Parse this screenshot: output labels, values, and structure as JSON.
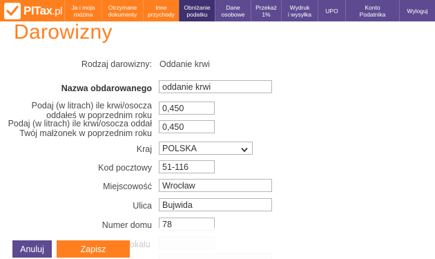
{
  "brand": {
    "name": "PITax",
    "suffix": ".pl"
  },
  "nav": [
    {
      "label": "Ja i moja\nrodzina",
      "style": "orange"
    },
    {
      "label": "Otrzymane\ndokumenty",
      "style": "orange"
    },
    {
      "label": "Inne\nprzychody",
      "style": "orange"
    },
    {
      "label": "Obniżanie\npodatku",
      "style": "active"
    },
    {
      "label": "Dane\nosobowe",
      "style": "purple"
    },
    {
      "label": "Przekaż\n1%",
      "style": "purple"
    },
    {
      "label": "Wydruk\ni wysyłka",
      "style": "purple"
    },
    {
      "label": "UPO",
      "style": "purple"
    },
    {
      "label": "Konto\nPodatnika",
      "style": "purple"
    },
    {
      "label": "Wyloguj",
      "style": "purple"
    }
  ],
  "page": {
    "title": "Darowizny"
  },
  "form": {
    "donation_type": {
      "label": "Rodzaj darowizny:",
      "value": "Oddanie krwi"
    },
    "recipient_name": {
      "label": "Nazwa obdarowanego",
      "value": "oddanie krwi"
    },
    "liters_own": {
      "label_line1": "Podaj (w litrach) ile krwi/osocza",
      "label_line2": "oddałeś w poprzednim roku",
      "value": "0,450"
    },
    "liters_spouse": {
      "label_line1": "Podaj (w litrach) ile krwi/osocza oddał",
      "label_line2": "Twój małżonek w poprzednim roku",
      "value": "0,450"
    },
    "country": {
      "label": "Kraj",
      "value": "POLSKA"
    },
    "postal_code": {
      "label": "Kod pocztowy",
      "value": "51-116"
    },
    "city": {
      "label": "Miejscowość",
      "value": "Wrocław"
    },
    "street": {
      "label": "Ulica",
      "value": "Bujwida"
    },
    "house_number": {
      "label": "Numer domu",
      "value": "78"
    },
    "apartment_label_fragment": "lokalu"
  },
  "actions": {
    "cancel": "Anuluj",
    "save": "Zapisz"
  },
  "colors": {
    "orange": "#ff7f1f",
    "purple": "#5d4a91",
    "active": "#3f306f"
  }
}
